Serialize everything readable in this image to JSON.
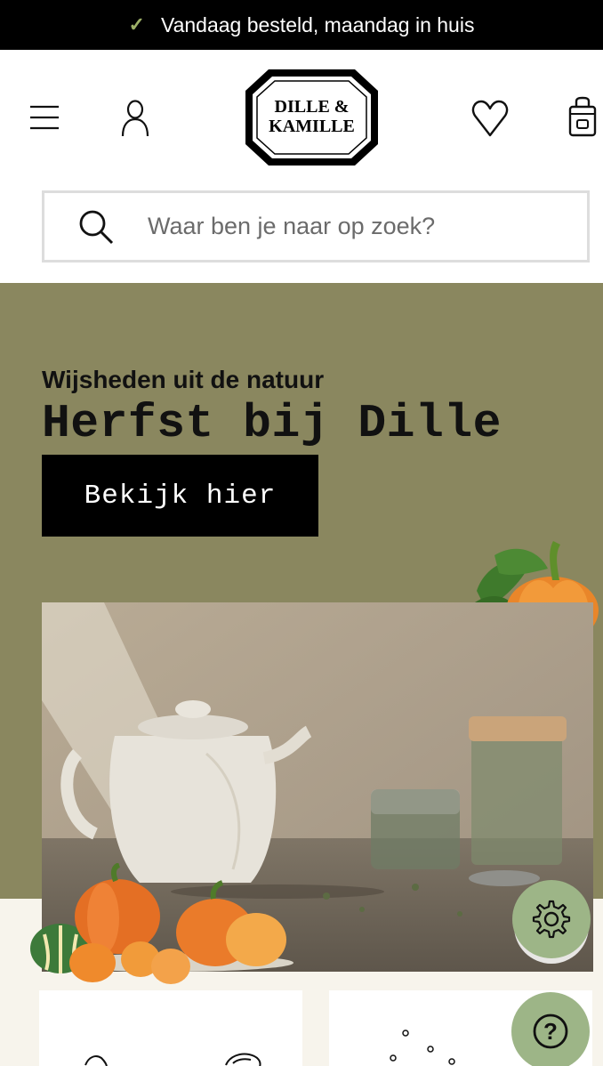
{
  "topbar": {
    "check_icon": "check-icon",
    "text": "Vandaag besteld, maandag in huis"
  },
  "header": {
    "menu_icon": "hamburger-icon",
    "account_icon": "user-icon",
    "logo": {
      "line1": "DILLE &",
      "line2": "KAMILLE"
    },
    "wishlist_icon": "heart-icon",
    "cart_icon": "shopping-bag-icon"
  },
  "search": {
    "icon": "search-icon",
    "placeholder": "Waar ben je naar op zoek?"
  },
  "hero": {
    "subtitle": "Wijsheden uit de natuur",
    "title": "Herfst bij Dille",
    "button_label": "Bekijk hier",
    "background_color": "#8a875f"
  },
  "floating": {
    "settings_icon": "gear-icon",
    "help_icon": "question-icon",
    "color": "#9db587"
  }
}
